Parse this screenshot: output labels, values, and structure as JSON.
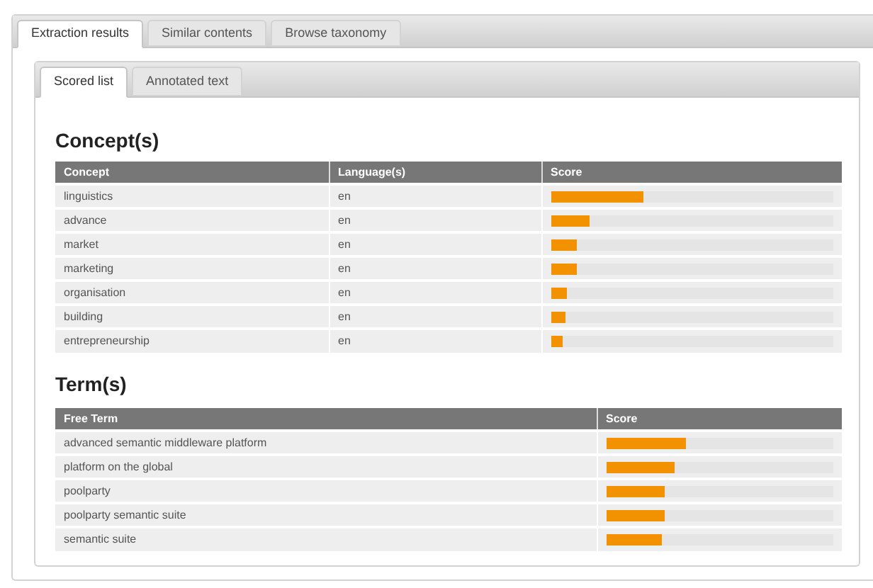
{
  "tabs": [
    {
      "label": "Extraction results",
      "selected": true
    },
    {
      "label": "Similar contents",
      "selected": false
    },
    {
      "label": "Browse taxonomy",
      "selected": false
    }
  ],
  "subtabs": [
    {
      "label": "Scored list",
      "selected": true
    },
    {
      "label": "Annotated text",
      "selected": false
    }
  ],
  "concepts": {
    "title": "Concept(s)",
    "columns": [
      "Concept",
      "Language(s)",
      "Score"
    ],
    "rows": [
      {
        "concept": "linguistics",
        "language": "en",
        "level": 0.33
      },
      {
        "concept": "advance",
        "language": "en",
        "level": 0.14
      },
      {
        "concept": "market",
        "language": "en",
        "level": 0.095
      },
      {
        "concept": "marketing",
        "language": "en",
        "level": 0.095
      },
      {
        "concept": "organisation",
        "language": "en",
        "level": 0.06
      },
      {
        "concept": "building",
        "language": "en",
        "level": 0.055
      },
      {
        "concept": "entrepreneurship",
        "language": "en",
        "level": 0.045
      }
    ]
  },
  "terms": {
    "title": "Term(s)",
    "columns": [
      "Free Term",
      "Score"
    ],
    "rows": [
      {
        "term": "advanced semantic middleware platform",
        "level": 0.35
      },
      {
        "term": "platform on the global",
        "level": 0.3
      },
      {
        "term": "poolparty",
        "level": 0.256
      },
      {
        "term": "poolparty semantic suite",
        "level": 0.256
      },
      {
        "term": "semantic suite",
        "level": 0.244
      }
    ]
  }
}
